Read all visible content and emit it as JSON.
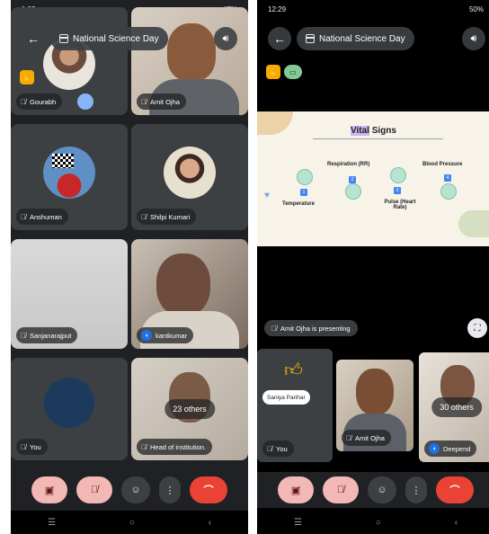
{
  "left": {
    "status_time": "1:09",
    "status_right": "47%",
    "meeting_title": "National Science Day",
    "tiles": [
      {
        "name": "Gourabh"
      },
      {
        "name": "Amit Ojha"
      },
      {
        "name": "Anshuman"
      },
      {
        "name": "Shilpi Kumari"
      },
      {
        "name": "Sanjanarajput"
      },
      {
        "name": "kantkumar"
      },
      {
        "name": "You"
      },
      {
        "name": "Head of institution."
      }
    ],
    "others_count": "23 others"
  },
  "right": {
    "status_time": "12:29",
    "status_right": "50%",
    "meeting_title": "National Science Day",
    "slide": {
      "title_highlight": "Vital",
      "title_rest": " Signs",
      "labels": {
        "respiration": "Respiration (RR)",
        "blood_pressure": "Blood Pressure",
        "temperature": "Temperature",
        "pulse": "Pulse (Heart Rate)"
      },
      "numbers": [
        "1",
        "2",
        "3",
        "4"
      ]
    },
    "presenting_text": "Amit Ojha is presenting",
    "tiles": [
      {
        "name": "You",
        "subtitle": "Saniya Parihar"
      },
      {
        "name": "Amit Ojha"
      },
      {
        "name": "Deepend"
      }
    ],
    "others_count": "30 others"
  },
  "colors": {
    "end_call": "#ea4335",
    "muted_control": "#f2b8b5",
    "speaking": "#1a73e8"
  }
}
